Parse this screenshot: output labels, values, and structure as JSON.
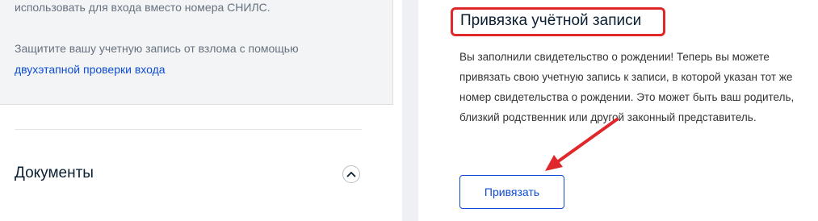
{
  "left": {
    "info_line_1": "использовать для входа вместо номера СНИЛС.",
    "info_line_2": "Защитите вашу учетную запись от взлома с помощью",
    "info_link": "двухэтапной проверки входа",
    "documents_title": "Документы",
    "collapse_icon": "chevron-up-icon"
  },
  "right": {
    "title": "Привязка учётной записи",
    "description_lines": [
      "Вы заполнили свидетельство о рождении! Теперь вы можете",
      "привязать свою учетную запись к записи, в которой указан тот же",
      "номер свидетельства о рождении. Это может быть ваш родитель,",
      "близкий родственник или другой законный представитель."
    ],
    "button_label": "Привязать"
  },
  "colors": {
    "link": "#0d4cd3",
    "highlight": "#e0282b",
    "annotation_arrow": "#e0282b"
  }
}
